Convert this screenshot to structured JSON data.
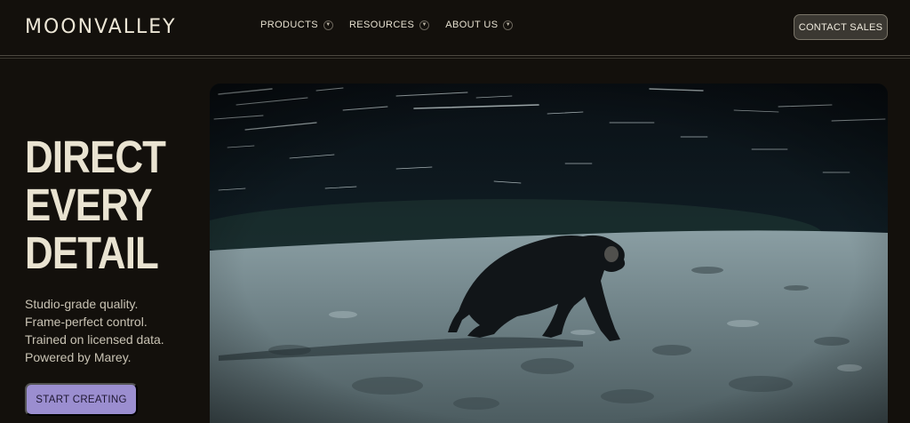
{
  "nav": {
    "logo": "MOONVALLEY",
    "menu": [
      {
        "label": "PRODUCTS"
      },
      {
        "label": "RESOURCES"
      },
      {
        "label": "ABOUT US"
      }
    ],
    "contact": "CONTACT SALES"
  },
  "hero": {
    "headline": [
      "DIRECT",
      "EVERY",
      "DETAIL"
    ],
    "subtext": [
      "Studio-grade quality.",
      "Frame-perfect control.",
      "Trained on licensed data.",
      "Powered by Marey."
    ],
    "cta": "START CREATING",
    "image_subject": "chimpanzee walking on lunar surface under star trails"
  },
  "colors": {
    "background": "#13100c",
    "accent": "#9b8ed0",
    "text": "#e9e3d1"
  }
}
